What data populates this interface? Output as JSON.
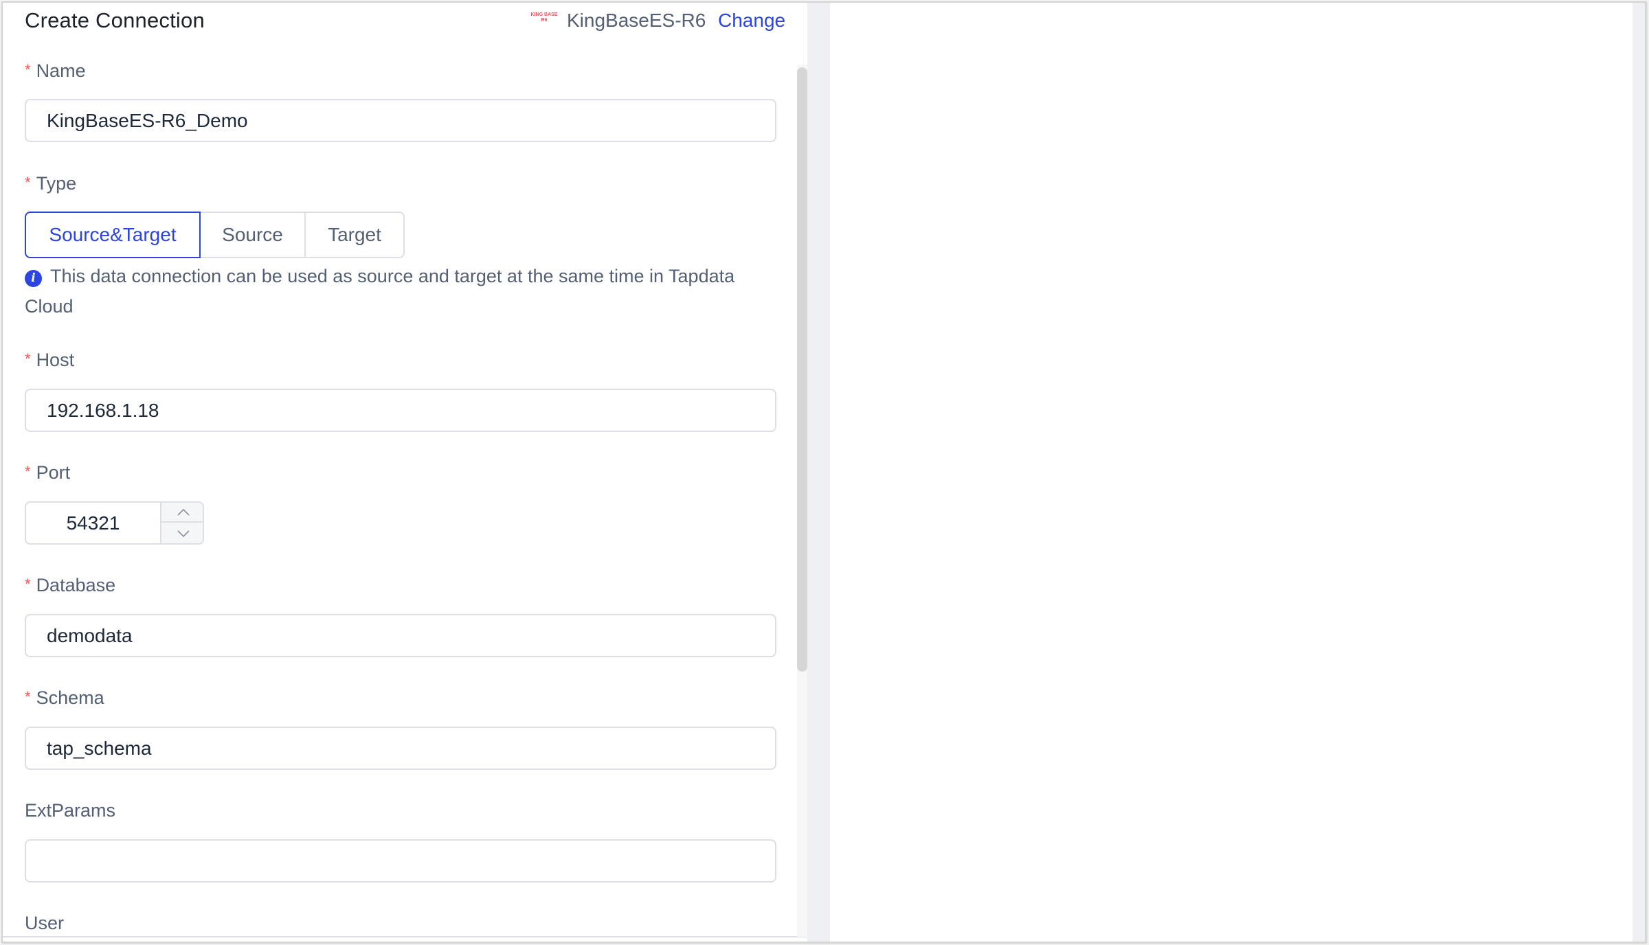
{
  "header": {
    "title": "Create Connection",
    "db_logo_line1": "KING BASE",
    "db_logo_line2": "R6",
    "db_name": "KingBaseES-R6",
    "change_label": "Change"
  },
  "colors": {
    "accent": "#2c44e0",
    "required": "#f05454",
    "label": "#535f72",
    "border": "#dcdfe6"
  },
  "form": {
    "required_mark": "*",
    "name": {
      "label": "Name",
      "value": "KingBaseES-R6_Demo"
    },
    "type": {
      "label": "Type",
      "options": [
        "Source&Target",
        "Source",
        "Target"
      ],
      "selected": "Source&Target",
      "info_icon": "info-icon",
      "info_text": "This data connection can be used as source and target at the same time in Tapdata Cloud"
    },
    "host": {
      "label": "Host",
      "value": "192.168.1.18"
    },
    "port": {
      "label": "Port",
      "value": "54321"
    },
    "database": {
      "label": "Database",
      "value": "demodata"
    },
    "schema": {
      "label": "Schema",
      "value": "tap_schema"
    },
    "ext_params": {
      "label": "ExtParams",
      "value": ""
    },
    "user": {
      "label": "User"
    }
  }
}
